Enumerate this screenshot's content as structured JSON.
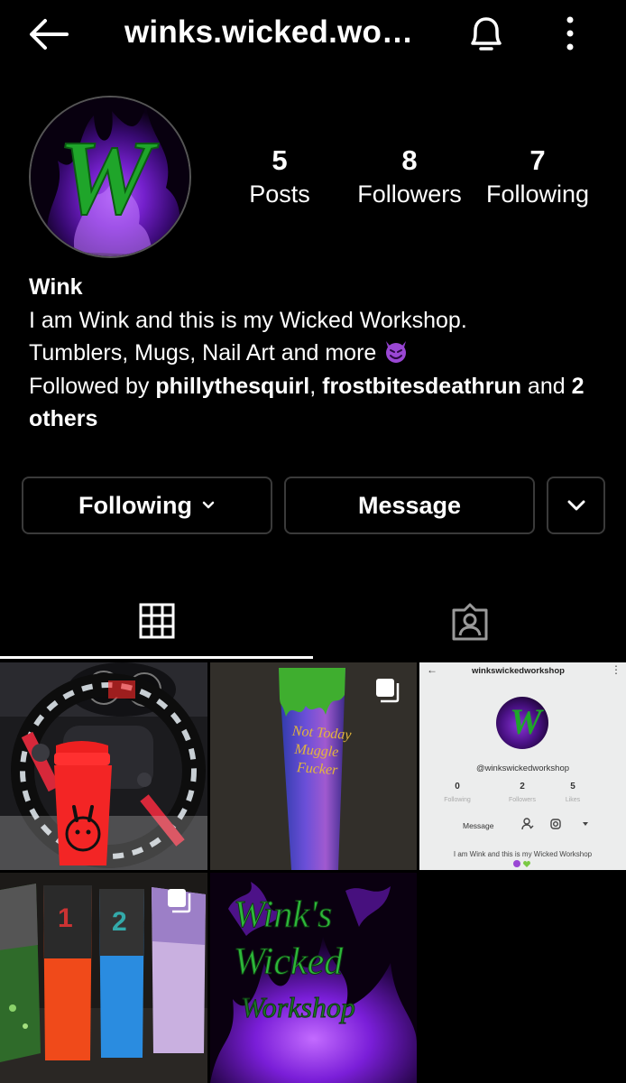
{
  "header": {
    "username": "winks.wicked.wo…",
    "back_icon": "arrow-left-icon",
    "bell_icon": "bell-icon",
    "more_icon": "more-vertical-icon"
  },
  "profile": {
    "avatar_letter": "W",
    "stats": [
      {
        "value": "5",
        "label": "Posts"
      },
      {
        "value": "8",
        "label": "Followers"
      },
      {
        "value": "7",
        "label": "Following"
      }
    ],
    "name": "Wink",
    "bio_line1": "I am Wink and this is my Wicked Workshop.",
    "bio_line2": "Tumblers, Mugs, Nail Art and more",
    "bio_emoji": "smiling-devil-emoji",
    "followed_prefix": "Followed by ",
    "followed_user1": "phillythesquirl",
    "followed_sep": ", ",
    "followed_user2": "frostbitesdeathrun",
    "followed_and": " and ",
    "followed_others": "2 others"
  },
  "actions": {
    "following_label": "Following",
    "message_label": "Message",
    "dropdown_icon": "chevron-down-icon"
  },
  "tabs": [
    {
      "icon": "grid-icon",
      "active": true
    },
    {
      "icon": "tagged-person-icon",
      "active": false
    }
  ],
  "posts": {
    "post2_text": [
      "Not Today",
      "Muggle",
      "Fucker"
    ],
    "post3": {
      "title": "winkswickedworkshop",
      "avatar_letter": "W",
      "handle": "@winkswickedworkshop",
      "stats": [
        {
          "value": "0",
          "label": "Following"
        },
        {
          "value": "2",
          "label": "Followers"
        },
        {
          "value": "5",
          "label": "Likes"
        }
      ],
      "message_label": "Message",
      "bio": "I am Wink and this is my Wicked Workshop"
    },
    "post5_text": [
      "Wink's",
      "Wicked",
      "Workshop"
    ]
  },
  "colors": {
    "background": "#000000",
    "button_border": "#3a3a3a",
    "accent_green": "#1fa52a",
    "accent_purple": "#8a33d8"
  }
}
